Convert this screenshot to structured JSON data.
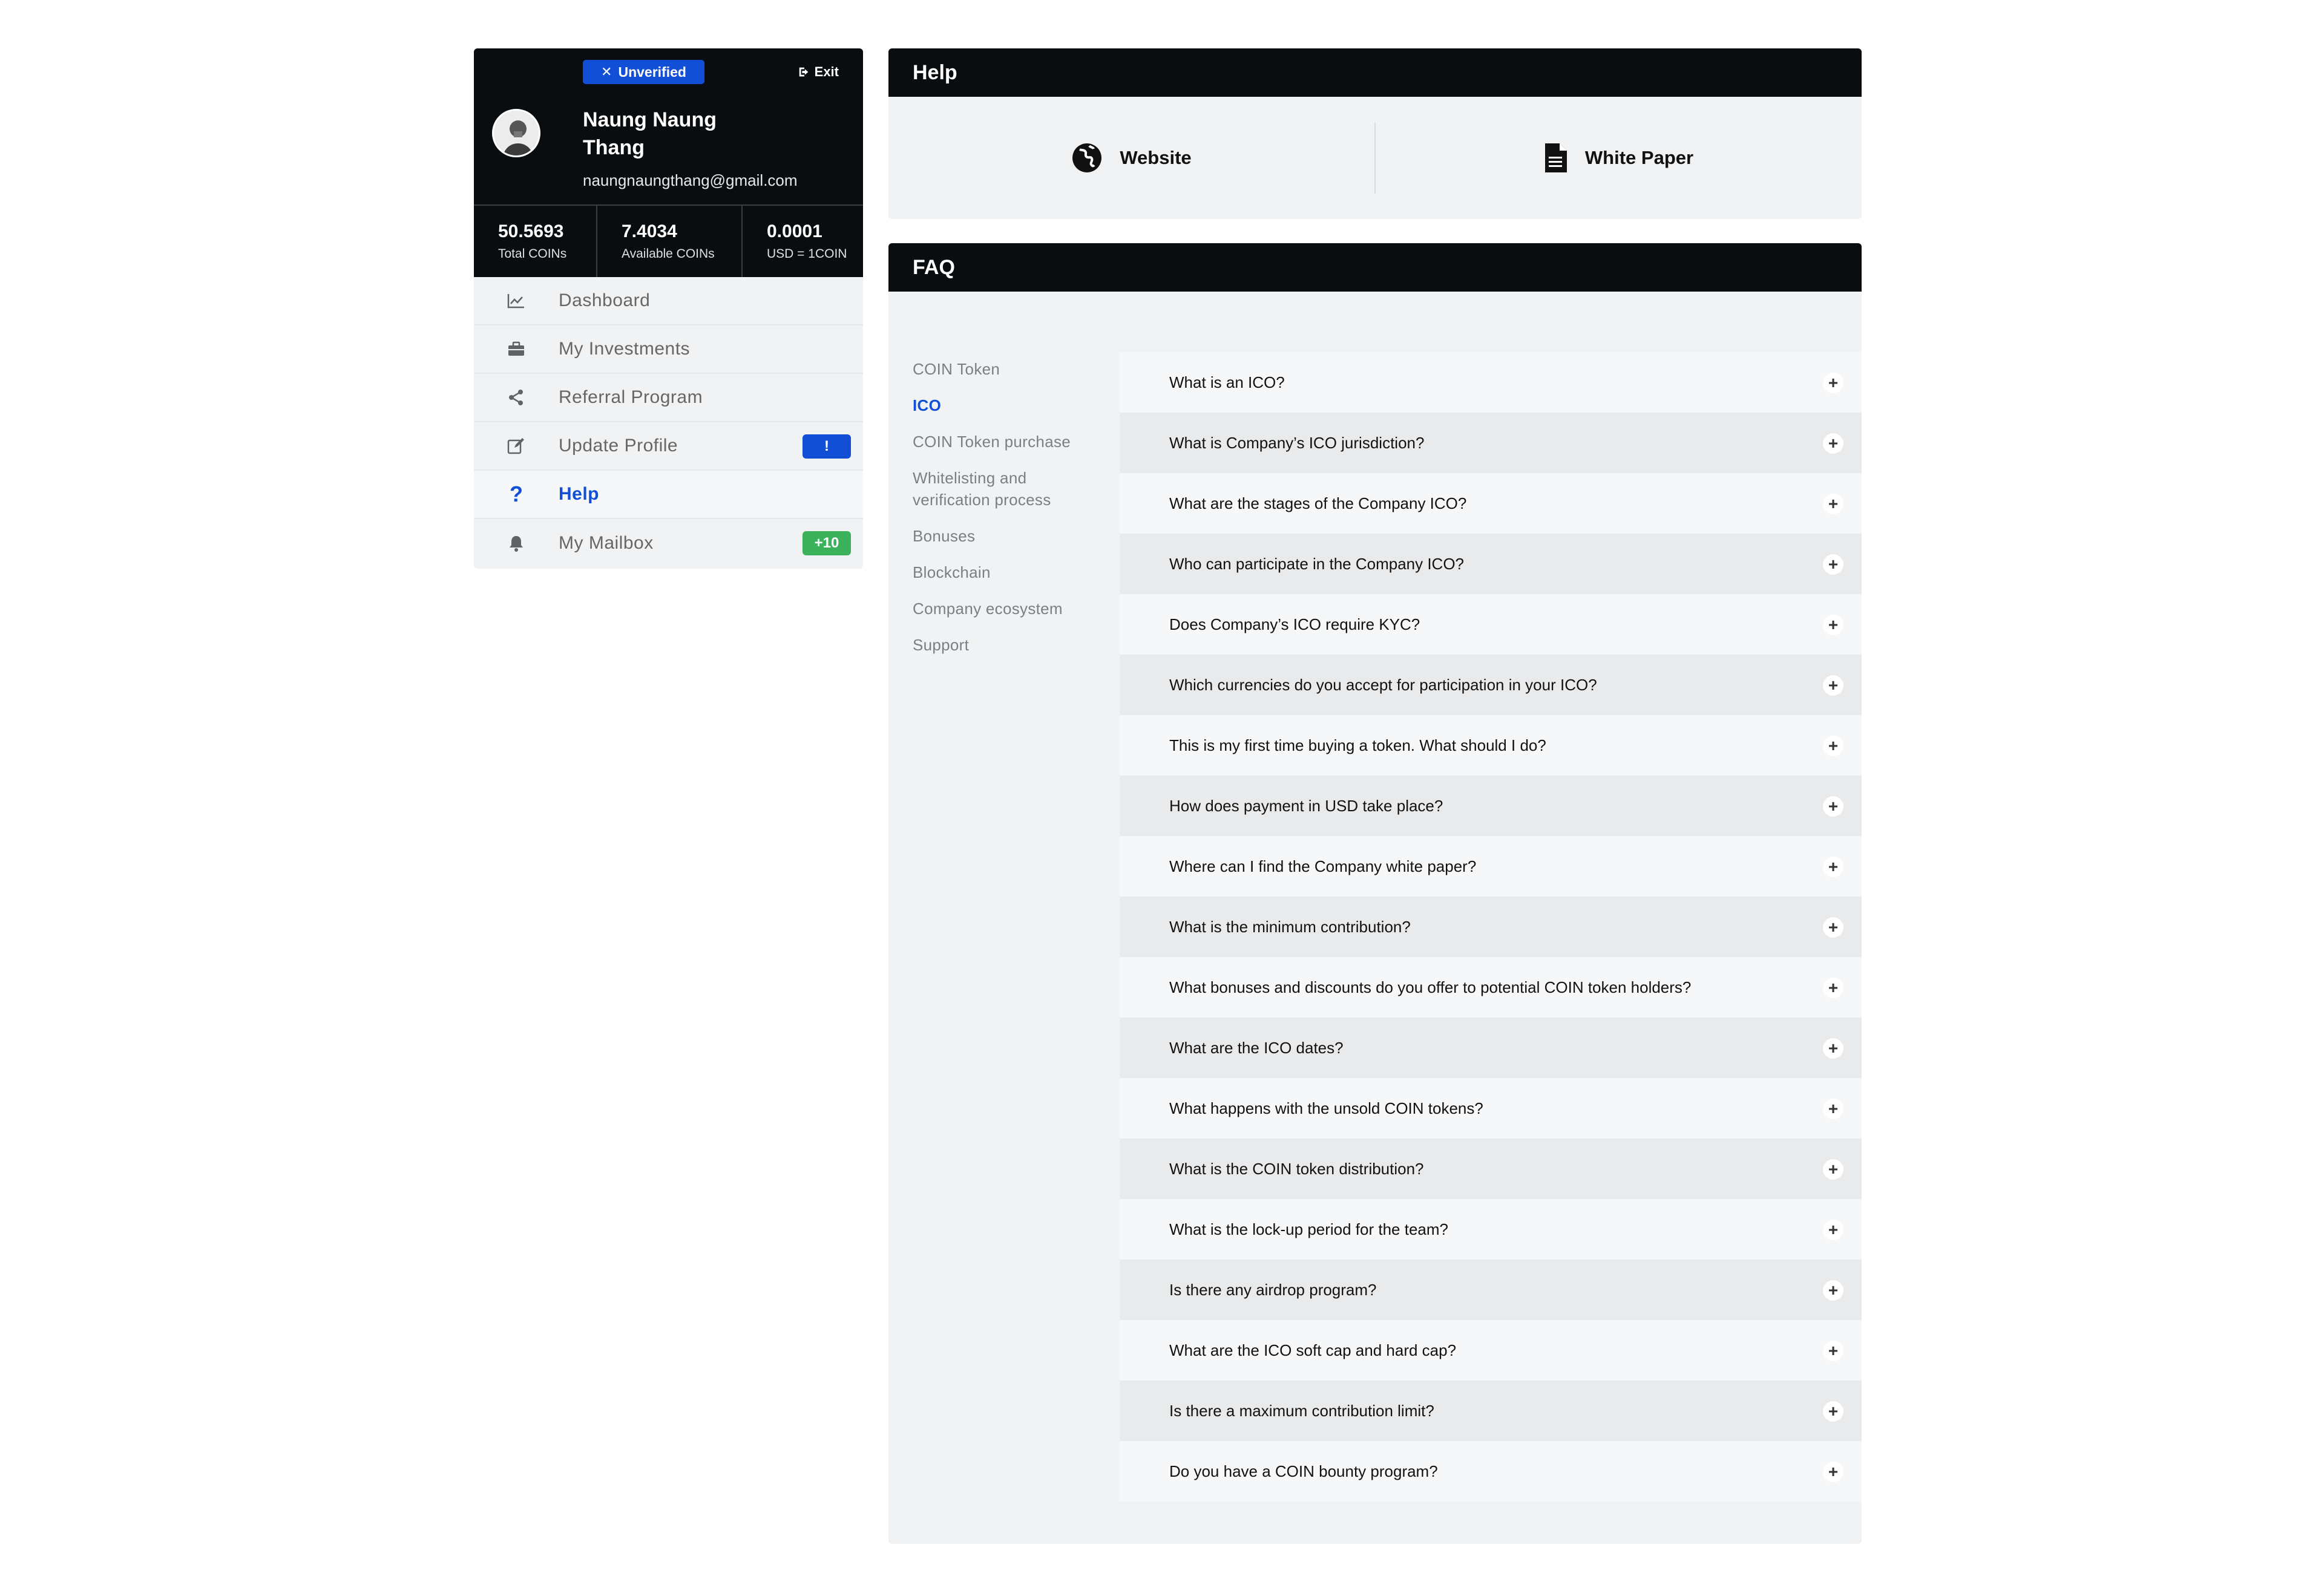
{
  "profile": {
    "status_badge": "Unverified",
    "exit_label": "Exit",
    "name": "Naung Naung Thang",
    "email": "naungnaungthang@gmail.com",
    "stats": [
      {
        "value": "50.5693",
        "label": "Total COINs"
      },
      {
        "value": "7.4034",
        "label": "Available COINs"
      },
      {
        "value": "0.0001",
        "label": "USD = 1COIN"
      }
    ]
  },
  "nav": {
    "items": [
      {
        "label": "Dashboard",
        "icon": "chart-line-icon"
      },
      {
        "label": "My Investments",
        "icon": "briefcase-icon"
      },
      {
        "label": "Referral Program",
        "icon": "share-icon"
      },
      {
        "label": "Update Profile",
        "icon": "edit-icon",
        "badge": "!",
        "badge_color": "#1150d6"
      },
      {
        "label": "Help",
        "icon": "question-icon",
        "active": true
      },
      {
        "label": "My Mailbox",
        "icon": "bell-icon",
        "badge": "+10",
        "badge_color": "#3ab15a"
      }
    ]
  },
  "help": {
    "title": "Help",
    "links": [
      {
        "label": "Website",
        "icon": "globe-icon"
      },
      {
        "label": "White Paper",
        "icon": "document-icon"
      }
    ]
  },
  "faq": {
    "title": "FAQ",
    "categories": [
      "COIN Token",
      "ICO",
      "COIN Token purchase",
      "Whitelisting and verification process",
      "Bonuses",
      "Blockchain",
      "Company ecosystem",
      "Support"
    ],
    "active_category": "ICO",
    "questions": [
      "What is an ICO?",
      "What is Company’s ICO jurisdiction?",
      "What are the stages of the Company ICO?",
      "Who can participate in the Company ICO?",
      "Does  Company’s ICO require KYC?",
      "Which currencies do you accept for participation in your ICO?",
      "This is my first time buying a token. What should I do?",
      "How does payment in USD take place?",
      "Where can I find the  Company white paper?",
      "What is the minimum contribution?",
      "What bonuses and discounts do you offer to potential COIN token holders?",
      "What are the ICO dates?",
      "What happens with the unsold COIN tokens?",
      "What is the COIN token distribution?",
      "What is the lock-up period for the team?",
      "Is there any airdrop program?",
      "What are the ICO soft cap and hard cap?",
      "Is there a maximum contribution limit?",
      "Do you have a COIN bounty program?"
    ],
    "expand_symbol": "+"
  },
  "colors": {
    "accent": "#1150d6",
    "header_bg": "#090d10",
    "panel_bg": "#f1f2f3",
    "mail_badge": "#3ab15a"
  }
}
